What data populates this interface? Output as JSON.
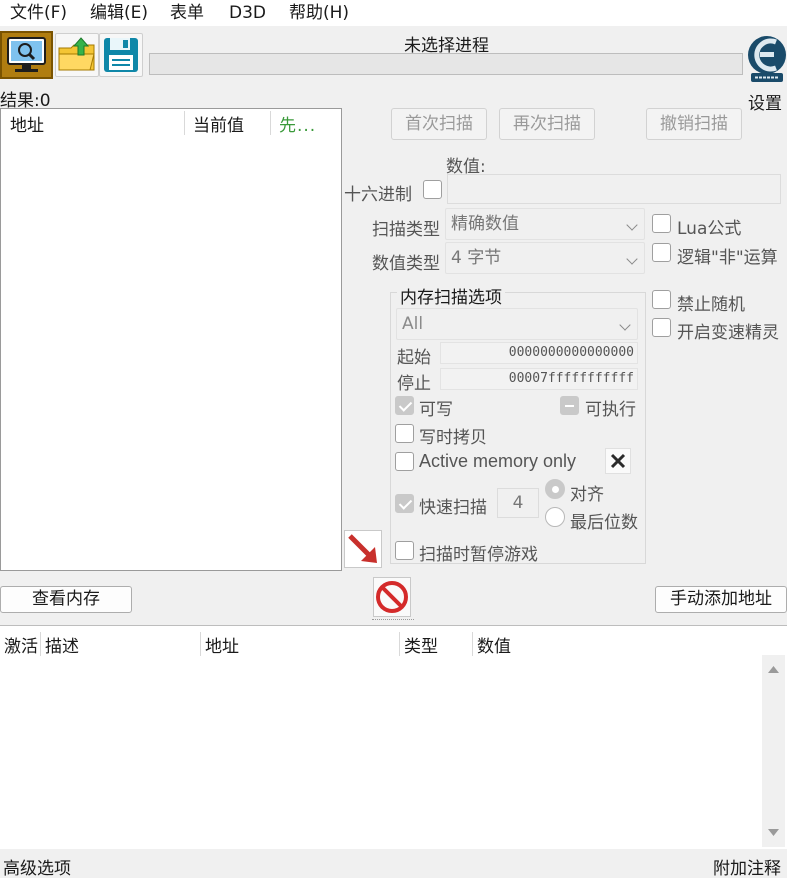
{
  "menu": {
    "file": "文件(F)",
    "edit": "编辑(E)",
    "table": "表单",
    "d3d": "D3D",
    "help": "帮助(H)"
  },
  "toolbar": {
    "process_title": "未选择进程",
    "settings": "设置",
    "results": "结果:0"
  },
  "address_list": {
    "columns": [
      "地址",
      "当前值",
      "先..."
    ]
  },
  "scan": {
    "first_scan": "首次扫描",
    "next_scan": "再次扫描",
    "undo_scan": "撤销扫描",
    "value_label": "数值:",
    "hex_label": "十六进制",
    "scan_type_label": "扫描类型",
    "scan_type_value": "精确数值",
    "value_type_label": "数值类型",
    "value_type_value": "4 字节",
    "lua_formula": "Lua公式",
    "not_logic": "逻辑\"非\"运算",
    "no_random": "禁止随机",
    "speedhack": "开启变速精灵"
  },
  "memory": {
    "group_title": "内存扫描选项",
    "region": "All",
    "start_label": "起始",
    "start_value": "0000000000000000",
    "stop_label": "停止",
    "stop_value": "00007fffffffffff",
    "writable": "可写",
    "executable": "可执行",
    "copy_on_write": "写时拷贝",
    "active_memory": "Active memory only",
    "fast_scan": "快速扫描",
    "fast_scan_value": "4",
    "align": "对齐",
    "last_digits": "最后位数",
    "pause_game": "扫描时暂停游戏"
  },
  "buttons": {
    "view_memory": "查看内存",
    "add_address": "手动添加地址"
  },
  "cheat_table": {
    "columns": [
      "激活",
      "描述",
      "地址",
      "类型",
      "数值"
    ]
  },
  "status": {
    "advanced": "高级选项",
    "comments": "附加注释"
  },
  "colors": {
    "accent_green": "#3a9a3a",
    "stop_red": "#d42a2a",
    "arrow_red": "#c8302c"
  }
}
